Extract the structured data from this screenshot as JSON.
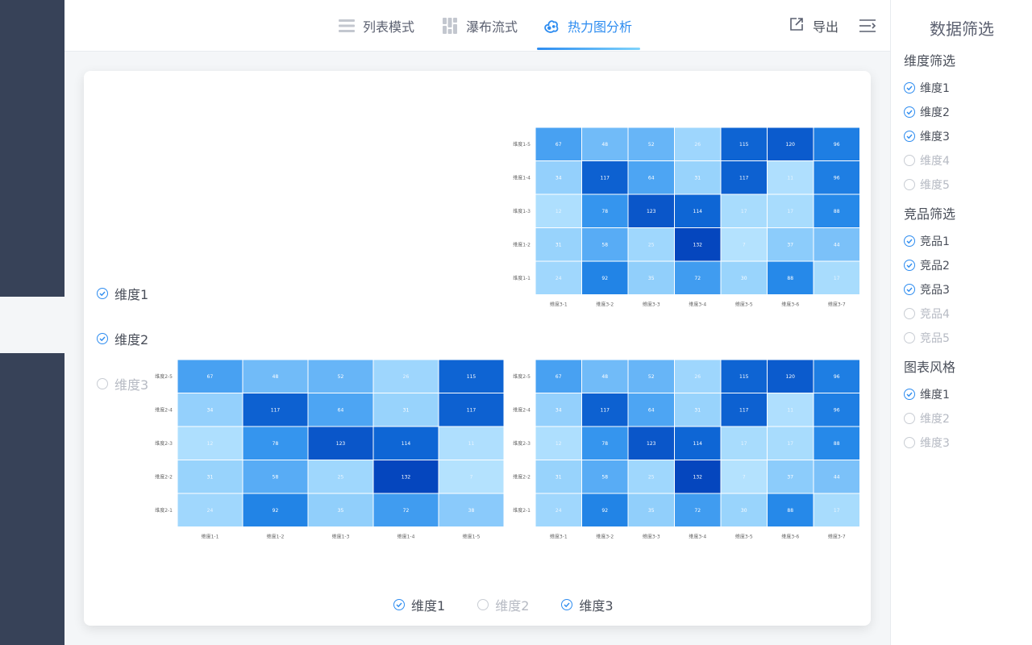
{
  "tabs": [
    {
      "label": "列表模式",
      "icon": "list-icon",
      "active": false
    },
    {
      "label": "瀑布流式",
      "icon": "waterfall-icon",
      "active": false
    },
    {
      "label": "热力图分析",
      "icon": "heatmap-icon",
      "active": true
    }
  ],
  "header": {
    "export_label": "导出"
  },
  "legend_vertical": [
    {
      "label": "维度1",
      "checked": true
    },
    {
      "label": "维度2",
      "checked": true
    },
    {
      "label": "维度3",
      "checked": false
    }
  ],
  "legend_bottom": [
    {
      "label": "维度1",
      "checked": true
    },
    {
      "label": "维度2",
      "checked": false
    },
    {
      "label": "维度3",
      "checked": true
    }
  ],
  "sidebar": {
    "title": "数据筛选",
    "groups": [
      {
        "title": "维度筛选",
        "items": [
          {
            "label": "维度1",
            "checked": true
          },
          {
            "label": "维度2",
            "checked": true
          },
          {
            "label": "维度3",
            "checked": true
          },
          {
            "label": "维度4",
            "checked": false
          },
          {
            "label": "维度5",
            "checked": false
          }
        ]
      },
      {
        "title": "竞品筛选",
        "items": [
          {
            "label": "竞品1",
            "checked": true
          },
          {
            "label": "竞品2",
            "checked": true
          },
          {
            "label": "竞品3",
            "checked": true
          },
          {
            "label": "竞品4",
            "checked": false
          },
          {
            "label": "竞品5",
            "checked": false
          }
        ]
      },
      {
        "title": "图表风格",
        "items": [
          {
            "label": "维度1",
            "checked": true
          },
          {
            "label": "维度2",
            "checked": false
          },
          {
            "label": "维度3",
            "checked": false
          }
        ]
      }
    ]
  },
  "colors": {
    "accent": "#2d8cf0",
    "sidebar_dark": "#374258"
  },
  "chart_data": [
    {
      "type": "heatmap",
      "x_categories": [
        "维度3-1",
        "维度3-2",
        "维度3-3",
        "维度3-4",
        "维度3-5",
        "维度3-6",
        "维度3-7"
      ],
      "y_categories": [
        "维度1-5",
        "维度1-4",
        "维度1-3",
        "维度1-2",
        "维度1-1"
      ],
      "values": [
        [
          67,
          48,
          52,
          26,
          115,
          120,
          96
        ],
        [
          34,
          117,
          64,
          31,
          117,
          11,
          96
        ],
        [
          12,
          78,
          123,
          114,
          17,
          17,
          88
        ],
        [
          31,
          58,
          25,
          132,
          7,
          37,
          44
        ],
        [
          24,
          92,
          35,
          72,
          30,
          88,
          17
        ]
      ],
      "vmin": 0,
      "vmax": 132
    },
    {
      "type": "heatmap",
      "x_categories": [
        "维度1-1",
        "维度1-2",
        "维度1-3",
        "维度1-4",
        "维度1-5"
      ],
      "y_categories": [
        "维度2-5",
        "维度2-4",
        "维度2-3",
        "维度2-2",
        "维度2-1"
      ],
      "values": [
        [
          67,
          48,
          52,
          26,
          115
        ],
        [
          34,
          117,
          64,
          31,
          117
        ],
        [
          12,
          78,
          123,
          114,
          11
        ],
        [
          31,
          58,
          25,
          132,
          7
        ],
        [
          24,
          92,
          35,
          72,
          38
        ]
      ],
      "vmin": 0,
      "vmax": 132
    },
    {
      "type": "heatmap",
      "x_categories": [
        "维度3-1",
        "维度3-2",
        "维度3-3",
        "维度3-4",
        "维度3-5",
        "维度3-6",
        "维度3-7"
      ],
      "y_categories": [
        "维度2-5",
        "维度2-4",
        "维度2-3",
        "维度2-2",
        "维度2-1"
      ],
      "values": [
        [
          67,
          48,
          52,
          26,
          115,
          120,
          96
        ],
        [
          34,
          117,
          64,
          31,
          117,
          11,
          96
        ],
        [
          12,
          78,
          123,
          114,
          17,
          17,
          88
        ],
        [
          31,
          58,
          25,
          132,
          7,
          37,
          44
        ],
        [
          24,
          92,
          35,
          72,
          30,
          88,
          17
        ]
      ],
      "vmin": 0,
      "vmax": 132
    }
  ]
}
